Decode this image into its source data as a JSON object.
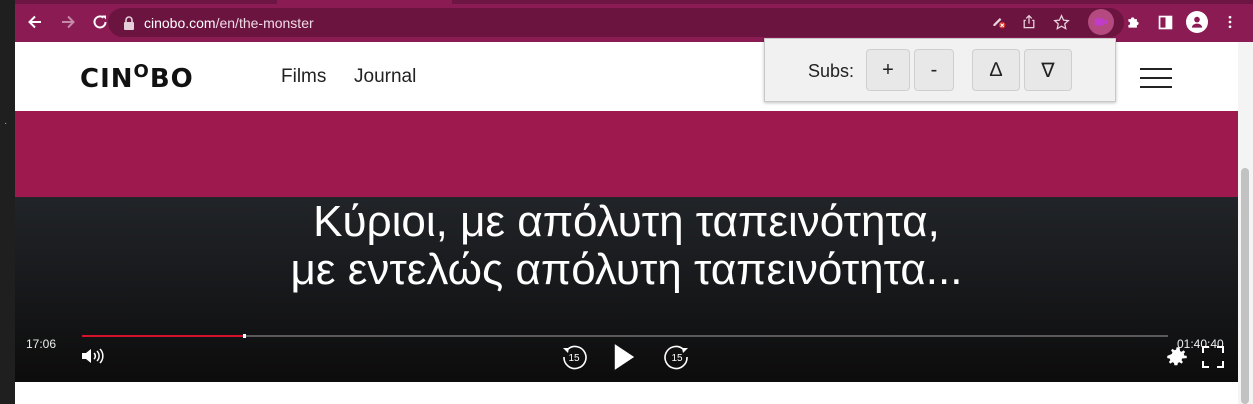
{
  "browser": {
    "url_domain": "cinobo.com",
    "url_path": "/en/the-monster",
    "icons": [
      "back-arrow-icon",
      "forward-arrow-icon",
      "reload-icon",
      "lock-icon",
      "camera-blocked-icon",
      "share-icon",
      "star-icon",
      "video-extension-icon",
      "puzzle-extensions-icon",
      "side-panel-icon",
      "profile-icon",
      "more-menu-icon"
    ]
  },
  "site": {
    "logo_prefix": "CIN",
    "logo_o": "O",
    "logo_suffix": "BO",
    "nav": {
      "films": "Films",
      "journal": "Journal"
    }
  },
  "subs_panel": {
    "label": "Subs:",
    "increase": "+",
    "decrease": "-",
    "move_up": "∆",
    "move_down": "∇"
  },
  "player": {
    "subtitle_line1": "Κύριοι, με απόλυτη ταπεινότητα,",
    "subtitle_line2": "με εντελώς απόλυτη ταπεινότητα...",
    "elapsed": "17:06",
    "duration": "01:40:40",
    "progress_fraction": 0.148,
    "rewind_seconds": "15",
    "forward_seconds": "15"
  },
  "colors": {
    "browser_frame": "#8a1b53",
    "page_accent": "#9e1a4e",
    "progress_played": "#d3122b"
  }
}
